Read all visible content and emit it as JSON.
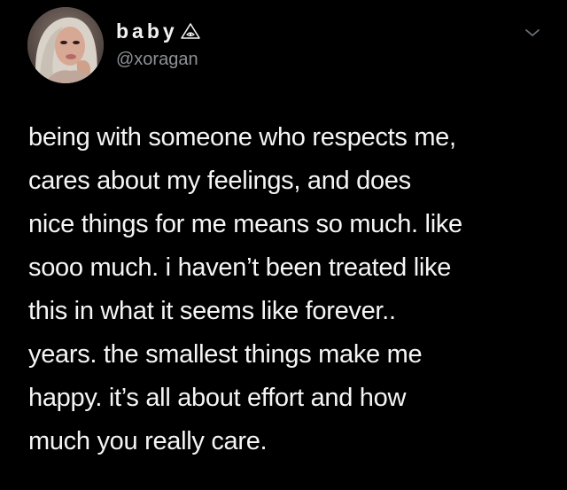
{
  "author": {
    "display_name": "baby",
    "handle": "@xoragan",
    "name_badge_icon": "triangle-eye-icon",
    "avatar_icon": "avatar-photo"
  },
  "menu": {
    "icon": "chevron-down-icon"
  },
  "tweet": {
    "lines": [
      "being with someone who respects me,",
      "cares about my feelings, and does",
      "nice things for me means so much. like",
      "sooo much. i haven’t been treated like",
      "this in what it seems like forever..",
      "years. the smallest things make me",
      "happy. it’s all about effort and how",
      "much you really care."
    ]
  },
  "colors": {
    "background": "#000000",
    "text": "#f5f5f5",
    "handle": "#8e9297"
  }
}
